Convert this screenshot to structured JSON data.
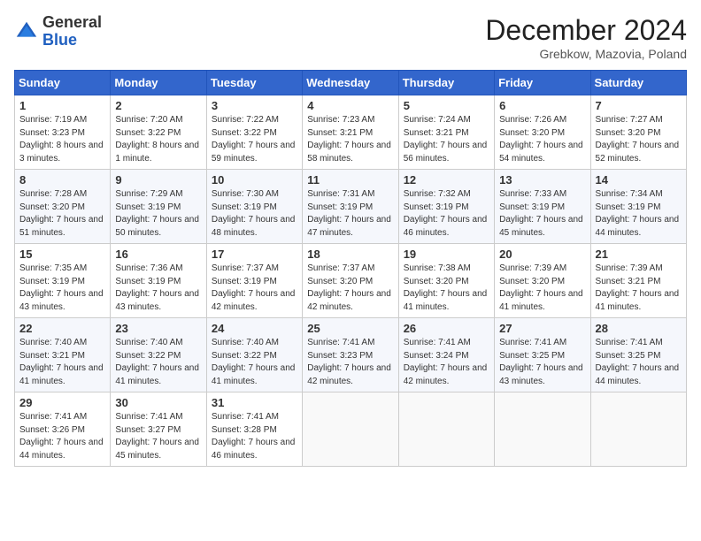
{
  "header": {
    "logo_general": "General",
    "logo_blue": "Blue",
    "month_title": "December 2024",
    "location": "Grebkow, Mazovia, Poland"
  },
  "weekdays": [
    "Sunday",
    "Monday",
    "Tuesday",
    "Wednesday",
    "Thursday",
    "Friday",
    "Saturday"
  ],
  "weeks": [
    [
      {
        "day": "1",
        "sunrise": "7:19 AM",
        "sunset": "3:23 PM",
        "daylight": "8 hours and 3 minutes."
      },
      {
        "day": "2",
        "sunrise": "7:20 AM",
        "sunset": "3:22 PM",
        "daylight": "8 hours and 1 minute."
      },
      {
        "day": "3",
        "sunrise": "7:22 AM",
        "sunset": "3:22 PM",
        "daylight": "7 hours and 59 minutes."
      },
      {
        "day": "4",
        "sunrise": "7:23 AM",
        "sunset": "3:21 PM",
        "daylight": "7 hours and 58 minutes."
      },
      {
        "day": "5",
        "sunrise": "7:24 AM",
        "sunset": "3:21 PM",
        "daylight": "7 hours and 56 minutes."
      },
      {
        "day": "6",
        "sunrise": "7:26 AM",
        "sunset": "3:20 PM",
        "daylight": "7 hours and 54 minutes."
      },
      {
        "day": "7",
        "sunrise": "7:27 AM",
        "sunset": "3:20 PM",
        "daylight": "7 hours and 52 minutes."
      }
    ],
    [
      {
        "day": "8",
        "sunrise": "7:28 AM",
        "sunset": "3:20 PM",
        "daylight": "7 hours and 51 minutes."
      },
      {
        "day": "9",
        "sunrise": "7:29 AM",
        "sunset": "3:19 PM",
        "daylight": "7 hours and 50 minutes."
      },
      {
        "day": "10",
        "sunrise": "7:30 AM",
        "sunset": "3:19 PM",
        "daylight": "7 hours and 48 minutes."
      },
      {
        "day": "11",
        "sunrise": "7:31 AM",
        "sunset": "3:19 PM",
        "daylight": "7 hours and 47 minutes."
      },
      {
        "day": "12",
        "sunrise": "7:32 AM",
        "sunset": "3:19 PM",
        "daylight": "7 hours and 46 minutes."
      },
      {
        "day": "13",
        "sunrise": "7:33 AM",
        "sunset": "3:19 PM",
        "daylight": "7 hours and 45 minutes."
      },
      {
        "day": "14",
        "sunrise": "7:34 AM",
        "sunset": "3:19 PM",
        "daylight": "7 hours and 44 minutes."
      }
    ],
    [
      {
        "day": "15",
        "sunrise": "7:35 AM",
        "sunset": "3:19 PM",
        "daylight": "7 hours and 43 minutes."
      },
      {
        "day": "16",
        "sunrise": "7:36 AM",
        "sunset": "3:19 PM",
        "daylight": "7 hours and 43 minutes."
      },
      {
        "day": "17",
        "sunrise": "7:37 AM",
        "sunset": "3:19 PM",
        "daylight": "7 hours and 42 minutes."
      },
      {
        "day": "18",
        "sunrise": "7:37 AM",
        "sunset": "3:20 PM",
        "daylight": "7 hours and 42 minutes."
      },
      {
        "day": "19",
        "sunrise": "7:38 AM",
        "sunset": "3:20 PM",
        "daylight": "7 hours and 41 minutes."
      },
      {
        "day": "20",
        "sunrise": "7:39 AM",
        "sunset": "3:20 PM",
        "daylight": "7 hours and 41 minutes."
      },
      {
        "day": "21",
        "sunrise": "7:39 AM",
        "sunset": "3:21 PM",
        "daylight": "7 hours and 41 minutes."
      }
    ],
    [
      {
        "day": "22",
        "sunrise": "7:40 AM",
        "sunset": "3:21 PM",
        "daylight": "7 hours and 41 minutes."
      },
      {
        "day": "23",
        "sunrise": "7:40 AM",
        "sunset": "3:22 PM",
        "daylight": "7 hours and 41 minutes."
      },
      {
        "day": "24",
        "sunrise": "7:40 AM",
        "sunset": "3:22 PM",
        "daylight": "7 hours and 41 minutes."
      },
      {
        "day": "25",
        "sunrise": "7:41 AM",
        "sunset": "3:23 PM",
        "daylight": "7 hours and 42 minutes."
      },
      {
        "day": "26",
        "sunrise": "7:41 AM",
        "sunset": "3:24 PM",
        "daylight": "7 hours and 42 minutes."
      },
      {
        "day": "27",
        "sunrise": "7:41 AM",
        "sunset": "3:25 PM",
        "daylight": "7 hours and 43 minutes."
      },
      {
        "day": "28",
        "sunrise": "7:41 AM",
        "sunset": "3:25 PM",
        "daylight": "7 hours and 44 minutes."
      }
    ],
    [
      {
        "day": "29",
        "sunrise": "7:41 AM",
        "sunset": "3:26 PM",
        "daylight": "7 hours and 44 minutes."
      },
      {
        "day": "30",
        "sunrise": "7:41 AM",
        "sunset": "3:27 PM",
        "daylight": "7 hours and 45 minutes."
      },
      {
        "day": "31",
        "sunrise": "7:41 AM",
        "sunset": "3:28 PM",
        "daylight": "7 hours and 46 minutes."
      },
      null,
      null,
      null,
      null
    ]
  ],
  "labels": {
    "sunrise": "Sunrise:",
    "sunset": "Sunset:",
    "daylight": "Daylight hours"
  }
}
